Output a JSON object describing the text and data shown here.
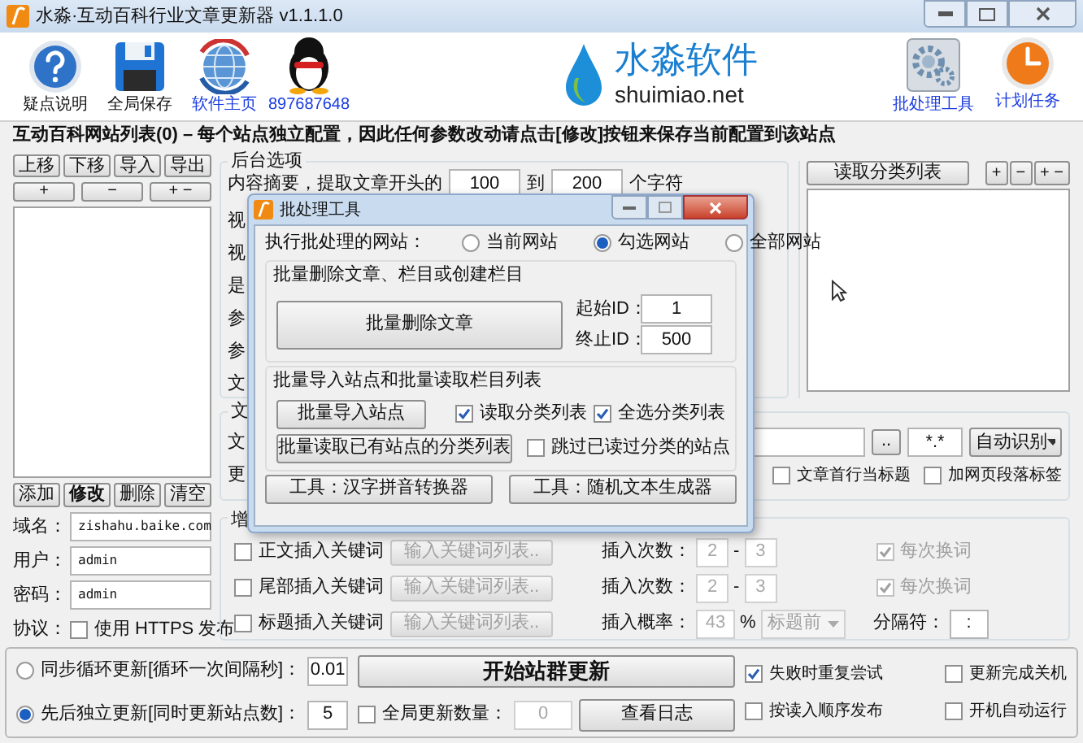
{
  "window": {
    "title": "水淼·互动百科行业文章更新器 v1.1.1.0"
  },
  "toolbar": {
    "left": [
      {
        "label": "疑点说明",
        "kind": "help",
        "link": false
      },
      {
        "label": "全局保存",
        "kind": "save",
        "link": false
      },
      {
        "label": "软件主页",
        "kind": "globe",
        "link": true
      },
      {
        "label": "897687648",
        "kind": "penguin",
        "link": true
      }
    ],
    "logo": {
      "name": "水淼软件",
      "domain": "shuimiao.net"
    },
    "right": [
      {
        "label": "批处理工具",
        "kind": "gear",
        "link": true
      },
      {
        "label": "计划任务",
        "kind": "clock",
        "link": true
      }
    ]
  },
  "header": "互动百科网站列表(0) – 每个站点独立配置，因此任何参数改动请点击[修改]按钮来保存当前配置到该站点",
  "site_list": {
    "top_buttons": [
      "上移",
      "下移",
      "导入",
      "导出"
    ],
    "tree_buttons": [
      "+",
      "−",
      "+ −"
    ],
    "actions": [
      {
        "label": "添加",
        "default": false
      },
      {
        "label": "修改",
        "default": true
      },
      {
        "label": "删除",
        "default": false
      },
      {
        "label": "清空",
        "default": false
      }
    ],
    "fields": [
      {
        "label": "域名：",
        "value": "zishahu.baike.com"
      },
      {
        "label": "用户：",
        "value": "admin"
      },
      {
        "label": "密码：",
        "value": "admin"
      }
    ],
    "protocol": {
      "label": "协议：",
      "checkbox": {
        "label": "使用 HTTPS 发布",
        "checked": false
      }
    }
  },
  "backend": {
    "title": "后台选项",
    "summary": {
      "label": "内容摘要，提取文章开头的",
      "from": "100",
      "to_label": "到",
      "to": "200",
      "unit": "个字符"
    },
    "cut_labels": [
      "视",
      "视",
      "是",
      "参",
      "参",
      "文"
    ]
  },
  "category": {
    "button": "读取分类列表",
    "tree_buttons": [
      "+",
      "−",
      "+ −"
    ]
  },
  "article": {
    "cut_title": "文",
    "cut_labels": [
      "文",
      "更"
    ],
    "browse": "..",
    "pattern": "*.*",
    "encoding": "自动识别",
    "checkboxes": [
      {
        "label": "文章首行当标题",
        "checked": false
      },
      {
        "label": "加网页段落标签",
        "checked": false
      }
    ]
  },
  "enhance": {
    "cut_title": "增",
    "rows": [
      {
        "kind": "count",
        "checkbox": {
          "label": "正文插入关键词",
          "checked": false
        },
        "keyword_button": "输入关键词列表..",
        "count_label": "插入次数：",
        "min": "2",
        "dash": "-",
        "max": "3",
        "change": {
          "label": "每次换词",
          "checked": true
        }
      },
      {
        "kind": "count",
        "checkbox": {
          "label": "尾部插入关键词",
          "checked": false
        },
        "keyword_button": "输入关键词列表..",
        "count_label": "插入次数：",
        "min": "2",
        "dash": "-",
        "max": "3",
        "change": {
          "label": "每次换词",
          "checked": true
        }
      },
      {
        "kind": "rate",
        "checkbox": {
          "label": "标题插入关键词",
          "checked": false
        },
        "keyword_button": "输入关键词列表..",
        "rate_label": "插入概率：",
        "rate": "43",
        "percent": "%",
        "position": "标题前",
        "separator_label": "分隔符：",
        "separator": ":"
      }
    ]
  },
  "bottom": {
    "modes": [
      {
        "label": "同步循环更新[循环一次间隔秒]：",
        "value": "0.01",
        "selected": false
      },
      {
        "label": "先后独立更新[同时更新站点数]：",
        "value": "5",
        "selected": true
      }
    ],
    "start": "开始站群更新",
    "global_count": {
      "label": "全局更新数量：",
      "value": "0",
      "checked": false
    },
    "log": "查看日志",
    "options": [
      {
        "label": "失败时重复尝试",
        "checked": true
      },
      {
        "label": "更新完成关机",
        "checked": false
      },
      {
        "label": "按读入顺序发布",
        "checked": false
      },
      {
        "label": "开机自动运行",
        "checked": false
      }
    ]
  },
  "dialog": {
    "title": "批处理工具",
    "target_label": "执行批处理的网站：",
    "targets": [
      {
        "label": "当前网站",
        "selected": false
      },
      {
        "label": "勾选网站",
        "selected": true
      },
      {
        "label": "全部网站",
        "selected": false
      }
    ],
    "delete_group": {
      "title": "批量删除文章、栏目或创建栏目",
      "button": "批量删除文章",
      "start_label": "起始ID：",
      "start": "1",
      "end_label": "终止ID：",
      "end": "500"
    },
    "import_group": {
      "title": "批量导入站点和批量读取栏目列表",
      "import_button": "批量导入站点",
      "read_button": "批量读取已有站点的分类列表",
      "checkboxes": [
        {
          "label": "读取分类列表",
          "checked": true
        },
        {
          "label": "全选分类列表",
          "checked": true
        },
        {
          "label": "跳过已读过分类的站点",
          "checked": false
        }
      ]
    },
    "tools": [
      "工具：汉字拼音转换器",
      "工具：随机文本生成器"
    ]
  }
}
